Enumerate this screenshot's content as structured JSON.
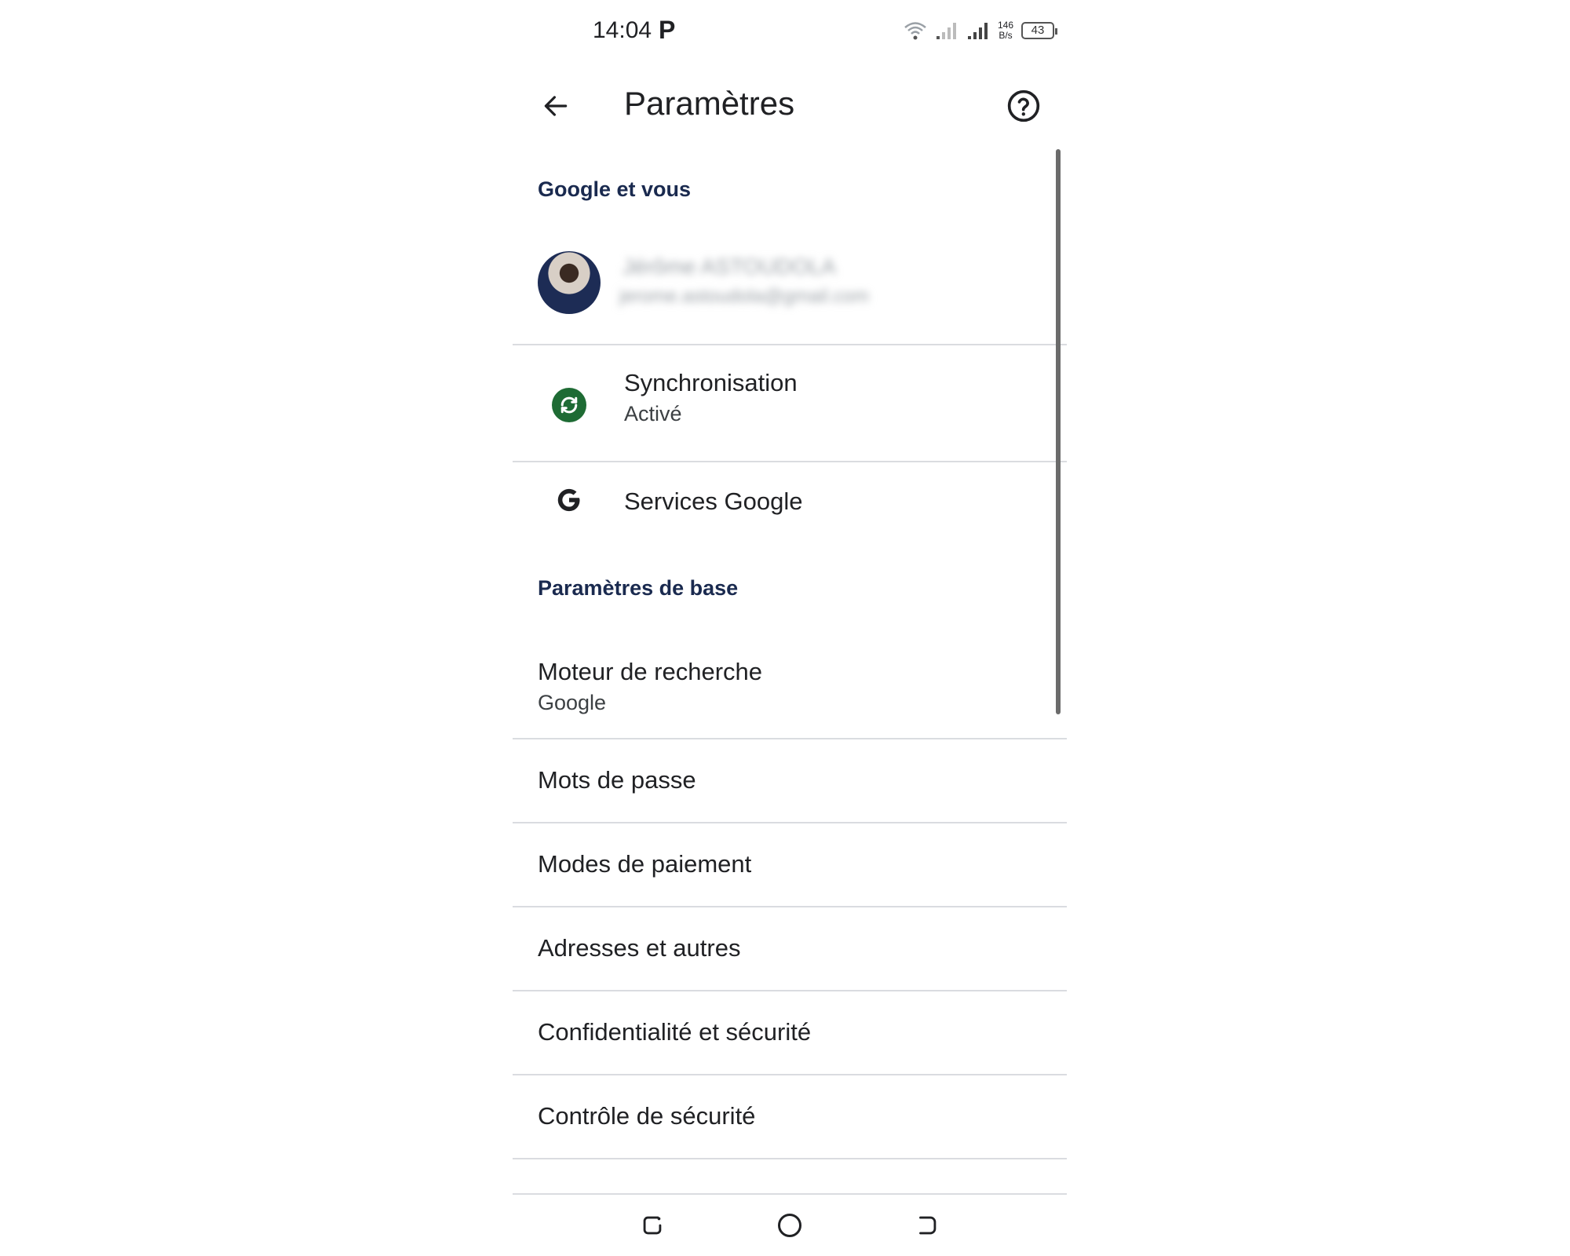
{
  "status_bar": {
    "time": "14:04",
    "notification_glyph": "P",
    "speed_value": "146",
    "speed_unit": "B/s",
    "battery_level": "43"
  },
  "header": {
    "title": "Paramètres",
    "back_icon": "arrow-left-icon",
    "help_icon": "help-circle-icon"
  },
  "sections": {
    "google_and_you": {
      "header": "Google et vous",
      "account": {
        "name": "Jérôme ASTOUDOLA",
        "email": "jerome.astoudola@gmail.com"
      },
      "sync": {
        "title": "Synchronisation",
        "subtitle": "Activé"
      },
      "services": {
        "title": "Services Google"
      }
    },
    "basics": {
      "header": "Paramètres de base",
      "search_engine": {
        "title": "Moteur de recherche",
        "subtitle": "Google"
      },
      "items": [
        "Mots de passe",
        "Modes de paiement",
        "Adresses et autres",
        "Confidentialité et sécurité",
        "Contrôle de sécurité"
      ]
    }
  },
  "colors": {
    "section_header": "#1a2a4f",
    "sync_green": "#1e6b34",
    "divider": "#dadce0"
  }
}
